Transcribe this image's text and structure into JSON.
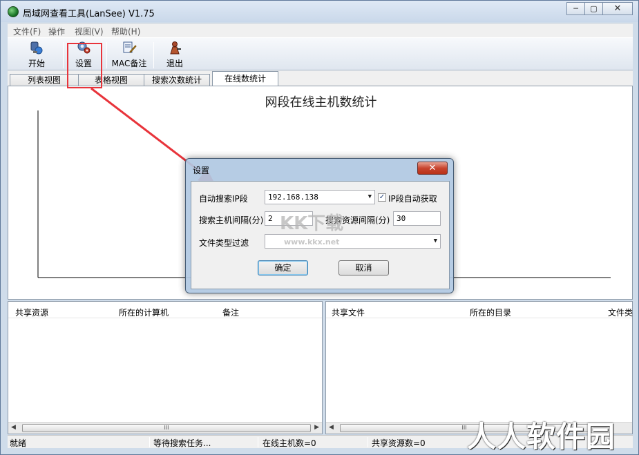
{
  "window": {
    "title": "局域网查看工具(LanSee) V1.75",
    "min_glyph": "─",
    "max_glyph": "▢",
    "close_glyph": "✕"
  },
  "menu": [
    "文件(F)",
    "操作",
    "视图(V)",
    "帮助(H)"
  ],
  "toolbar": {
    "start": "开始",
    "settings": "设置",
    "mac_note": "MAC备注",
    "exit": "退出"
  },
  "tabs": [
    "列表视图",
    "表格视图",
    "搜索次数统计",
    "在线数统计"
  ],
  "chart": {
    "title": "网段在线主机数统计"
  },
  "left_panel": {
    "columns": [
      "共享资源",
      "所在的计算机",
      "备注"
    ],
    "scroll_thumb": "III"
  },
  "right_panel": {
    "columns": [
      "共享文件",
      "所在的目录",
      "文件类"
    ],
    "scroll_thumb": "III"
  },
  "status": [
    "就绪",
    "等待搜索任务...",
    "在线主机数=0",
    "共享资源数=0"
  ],
  "dialog": {
    "title": "设置",
    "close_glyph": "✕",
    "auto_ip_label": "自动搜索IP段",
    "auto_ip_value": "192.168.138",
    "auto_ip_checkbox_label": "IP段自动获取",
    "auto_ip_checkbox_checked": true,
    "host_interval_label": "搜索主机间隔(分)",
    "host_interval_value": "2",
    "resource_interval_label": "搜索资源间隔(分)",
    "resource_interval_value": "30",
    "file_filter_label": "文件类型过滤",
    "file_filter_value": "",
    "ok_label": "确定",
    "cancel_label": "取消"
  },
  "watermarks": {
    "kk": "KK下载",
    "kk_url": "www.kkx.net",
    "corner": "人人软件园"
  },
  "colors": {
    "annotation_red": "#e8343b",
    "titlebar_bg": "#dfe9f5",
    "dialog_close": "#c8452f"
  }
}
